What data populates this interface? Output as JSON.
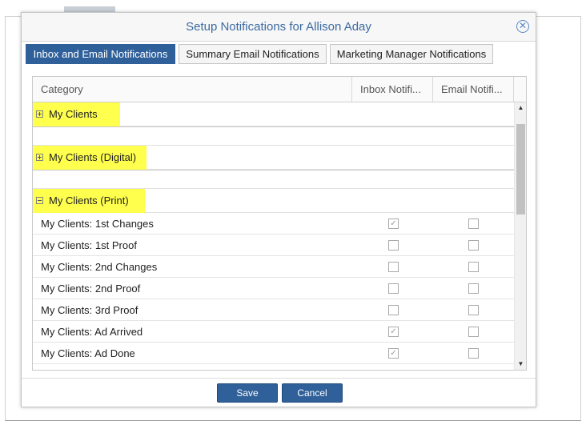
{
  "dialog": {
    "title": "Setup Notifications for Allison Aday",
    "close_glyph": "✕"
  },
  "tabs": [
    {
      "label": "Inbox and Email Notifications",
      "active": true
    },
    {
      "label": "Summary Email Notifications",
      "active": false
    },
    {
      "label": "Marketing Manager Notifications",
      "active": false
    }
  ],
  "grid": {
    "columns": [
      "Category",
      "Inbox Notifi...",
      "Email Notifi..."
    ],
    "groups": [
      {
        "label": "My Clients",
        "expanded": false,
        "highlight": true
      },
      {
        "label": "My Clients (Digital)",
        "expanded": false,
        "highlight": true
      },
      {
        "label": "My Clients (Print)",
        "expanded": true,
        "highlight": true
      }
    ],
    "rows": [
      {
        "label": "My Clients: 1st Changes",
        "inbox": true,
        "email": false
      },
      {
        "label": "My Clients: 1st Proof",
        "inbox": false,
        "email": false
      },
      {
        "label": "My Clients: 2nd Changes",
        "inbox": false,
        "email": false
      },
      {
        "label": "My Clients: 2nd Proof",
        "inbox": false,
        "email": false
      },
      {
        "label": "My Clients: 3rd Proof",
        "inbox": false,
        "email": false
      },
      {
        "label": "My Clients: Ad Arrived",
        "inbox": true,
        "email": false
      },
      {
        "label": "My Clients: Ad Done",
        "inbox": true,
        "email": false
      }
    ],
    "scroll": {
      "up_glyph": "▲",
      "down_glyph": "▼"
    }
  },
  "footer": {
    "save_label": "Save",
    "cancel_label": "Cancel"
  },
  "colors": {
    "accent": "#2f6099",
    "title_text": "#3b6aa0",
    "highlight": "#ffff4d"
  },
  "icons": {
    "close": "close-circle-icon",
    "expand": "plus-box-icon",
    "collapse": "minus-box-icon",
    "check": "checkmark-icon"
  }
}
